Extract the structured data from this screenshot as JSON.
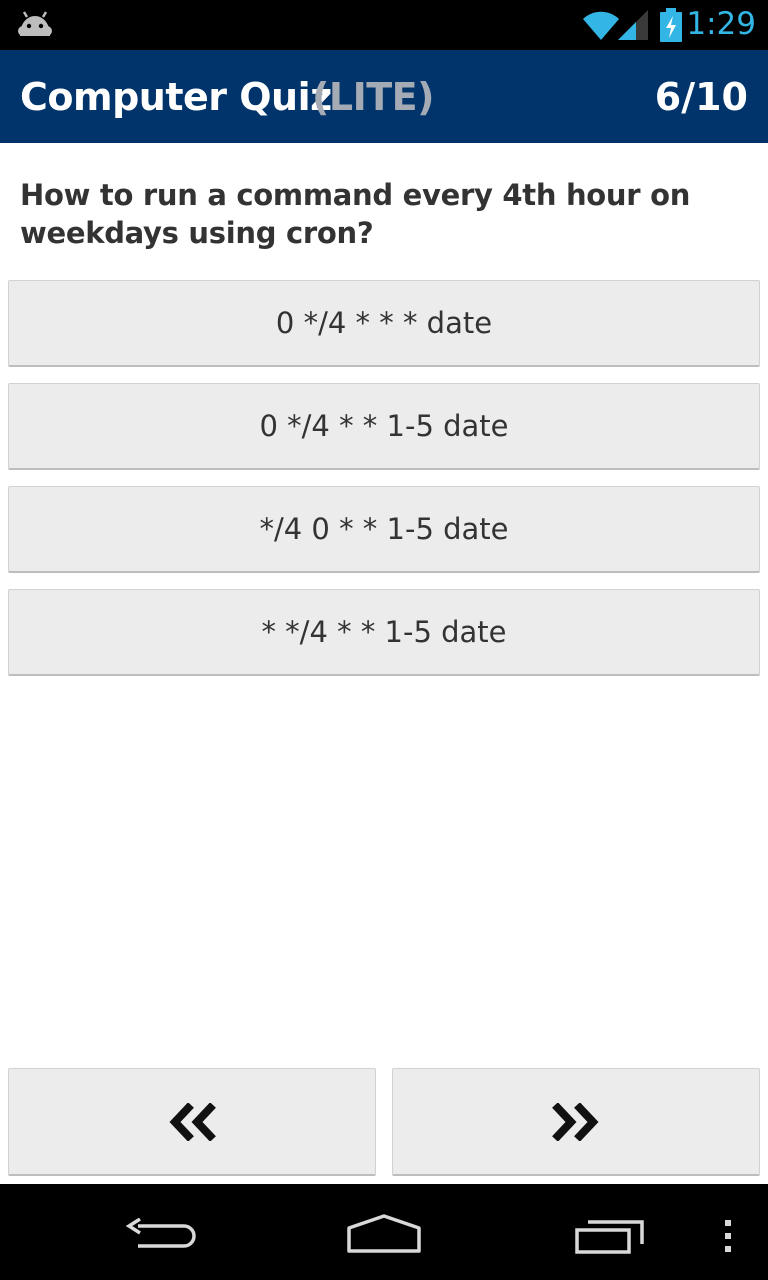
{
  "status_bar": {
    "time": "1:29",
    "icons": [
      "android-icon",
      "wifi-icon",
      "signal-icon",
      "battery-charging-icon"
    ],
    "accent_color": "#33b5e5"
  },
  "header": {
    "title": "Computer Quiz",
    "badge": "(LITE)",
    "progress": "6/10",
    "background_color": "#01346b"
  },
  "question": {
    "text": "How to run a command every 4th hour on weekdays using cron?"
  },
  "answers": [
    {
      "label": "0 */4 * * * date"
    },
    {
      "label": "0 */4 * * 1-5 date"
    },
    {
      "label": "*/4 0 * * 1-5 date"
    },
    {
      "label": "* */4 * * 1-5 date"
    }
  ],
  "navigation": {
    "previous_icon": "double-chevron-left-icon",
    "next_icon": "double-chevron-right-icon"
  },
  "system_nav": {
    "icons": [
      "back-icon",
      "home-icon",
      "recent-apps-icon",
      "overflow-menu-icon"
    ]
  }
}
